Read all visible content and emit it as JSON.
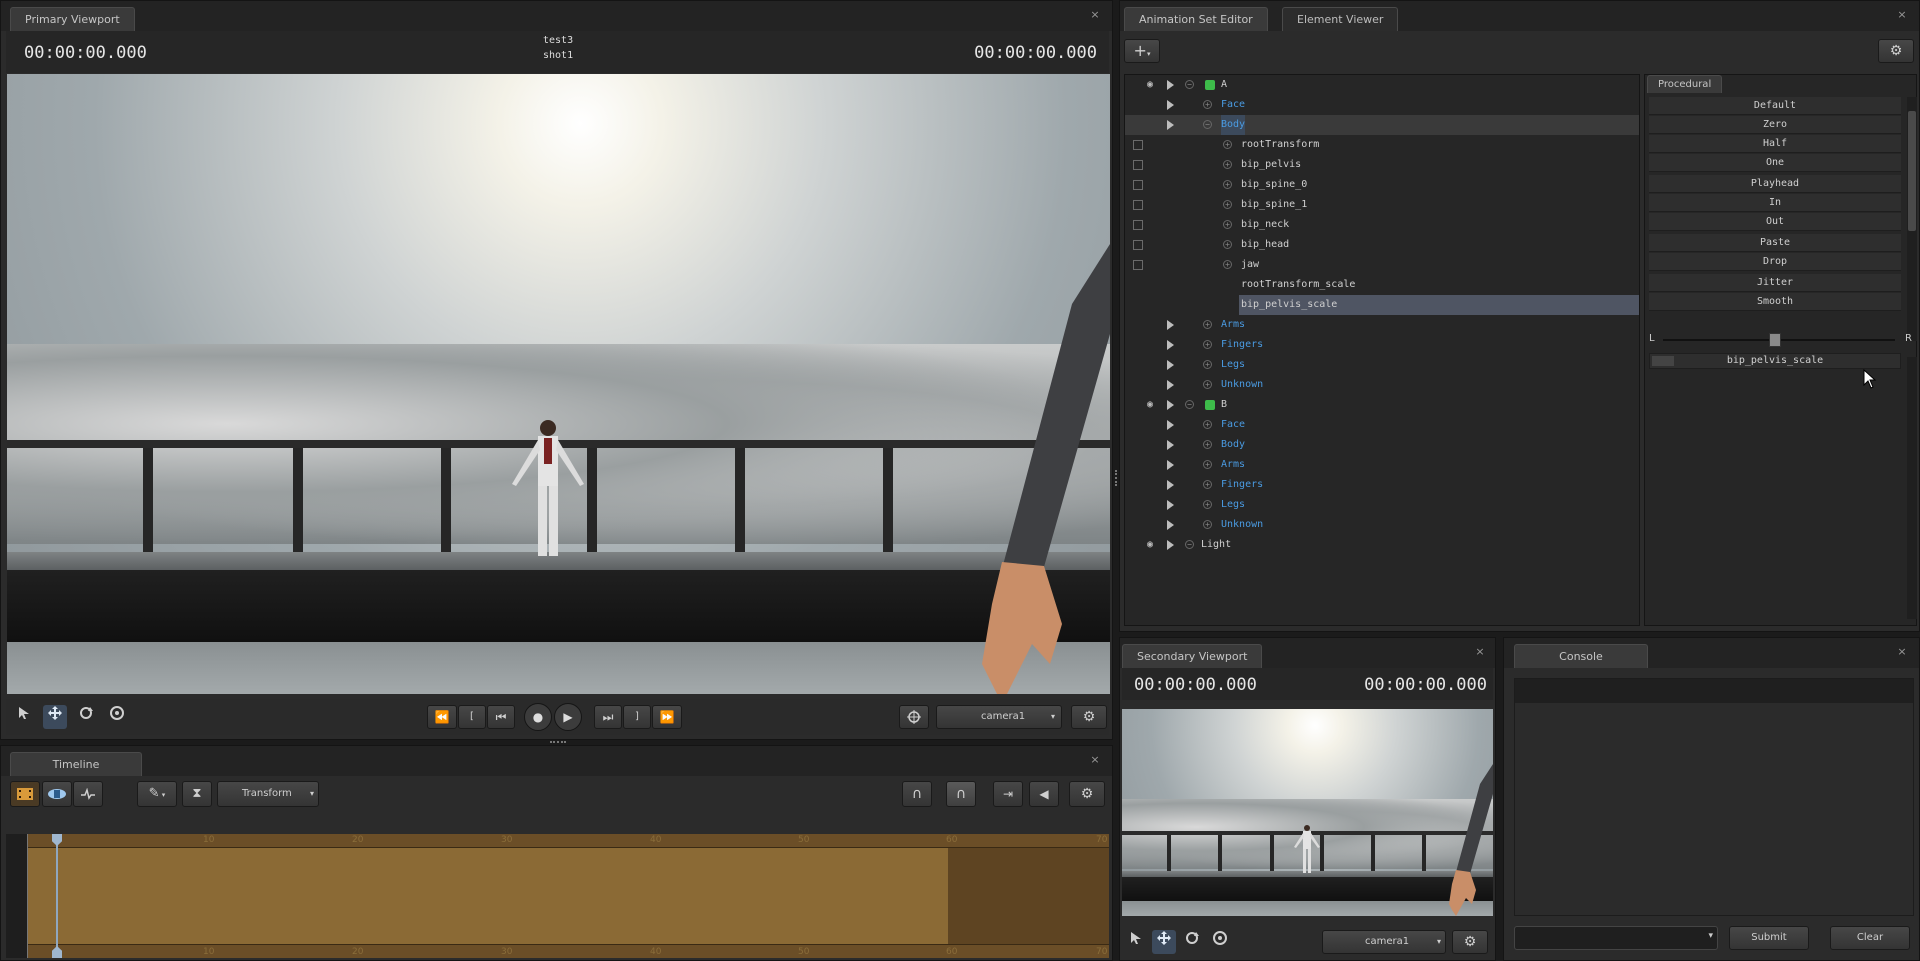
{
  "primary_viewport": {
    "tab": "Primary Viewport",
    "close": "×",
    "time_left": "00:00:00.000",
    "time_right": "00:00:00.000",
    "session": "test3",
    "shot": "shot1",
    "camera": "camera1",
    "toolbar": {
      "select": "select-arrow",
      "move": "move",
      "rotate": "rotate",
      "scale": "scale",
      "rewind": "⏪",
      "mark_in": "[",
      "prev": "⏮",
      "record": "●",
      "play": "▶",
      "next": "⏭",
      "mark_out": "]",
      "forward": "⏩"
    }
  },
  "timeline": {
    "tab": "Timeline",
    "close": "×",
    "mode": "Transform",
    "ruler_ticks": [
      "10",
      "20",
      "30",
      "40",
      "50",
      "60",
      "70"
    ]
  },
  "animation_set_editor": {
    "tabs": [
      "Animation Set Editor",
      "Element Viewer"
    ],
    "close": "×",
    "add": "+",
    "tree": [
      {
        "label": "A",
        "color": "white",
        "level": 0,
        "eye": true,
        "cube": true
      },
      {
        "label": "Face",
        "color": "blue",
        "level": 1
      },
      {
        "label": "Body",
        "color": "blue",
        "level": 1,
        "selected": true
      },
      {
        "label": "rootTransform",
        "color": "white",
        "level": 2,
        "check": true
      },
      {
        "label": "bip_pelvis",
        "color": "white",
        "level": 2,
        "check": true
      },
      {
        "label": "bip_spine_0",
        "color": "white",
        "level": 2,
        "check": true
      },
      {
        "label": "bip_spine_1",
        "color": "white",
        "level": 2,
        "check": true
      },
      {
        "label": "bip_neck",
        "color": "white",
        "level": 2,
        "check": true
      },
      {
        "label": "bip_head",
        "color": "white",
        "level": 2,
        "check": true
      },
      {
        "label": "jaw",
        "color": "white",
        "level": 2,
        "check": true
      },
      {
        "label": "rootTransform_scale",
        "color": "white",
        "level": 3
      },
      {
        "label": "bip_pelvis_scale",
        "color": "white",
        "level": 3,
        "highlight": true
      },
      {
        "label": "Arms",
        "color": "blue",
        "level": 1
      },
      {
        "label": "Fingers",
        "color": "blue",
        "level": 1
      },
      {
        "label": "Legs",
        "color": "blue",
        "level": 1
      },
      {
        "label": "Unknown",
        "color": "blue",
        "level": 1
      },
      {
        "label": "B",
        "color": "white",
        "level": 0,
        "eye": true,
        "cube": true
      },
      {
        "label": "Face",
        "color": "blue",
        "level": 1
      },
      {
        "label": "Body",
        "color": "blue",
        "level": 1
      },
      {
        "label": "Arms",
        "color": "blue",
        "level": 1
      },
      {
        "label": "Fingers",
        "color": "blue",
        "level": 1
      },
      {
        "label": "Legs",
        "color": "blue",
        "level": 1
      },
      {
        "label": "Unknown",
        "color": "blue",
        "level": 1
      },
      {
        "label": "Light",
        "color": "white",
        "level": 0,
        "eye": true
      }
    ],
    "procedural": {
      "tab": "Procedural",
      "items": [
        "Default",
        "Zero",
        "Half",
        "One",
        "Playhead",
        "In",
        "Out",
        "Paste",
        "Drop",
        "Jitter",
        "Smooth"
      ],
      "slider_left": "L",
      "slider_right": "R",
      "selected_control": "bip_pelvis_scale"
    }
  },
  "secondary_viewport": {
    "tab": "Secondary Viewport",
    "close": "×",
    "time_left": "00:00:00.000",
    "time_right": "00:00:00.000",
    "camera": "camera1"
  },
  "console": {
    "tab": "Console",
    "close": "×",
    "submit": "Submit",
    "clear": "Clear"
  },
  "colors": {
    "tree_blue": "#4a9be2",
    "timeline_bar": "#8b6a35",
    "timeline_bar_dark": "#5e4422"
  }
}
